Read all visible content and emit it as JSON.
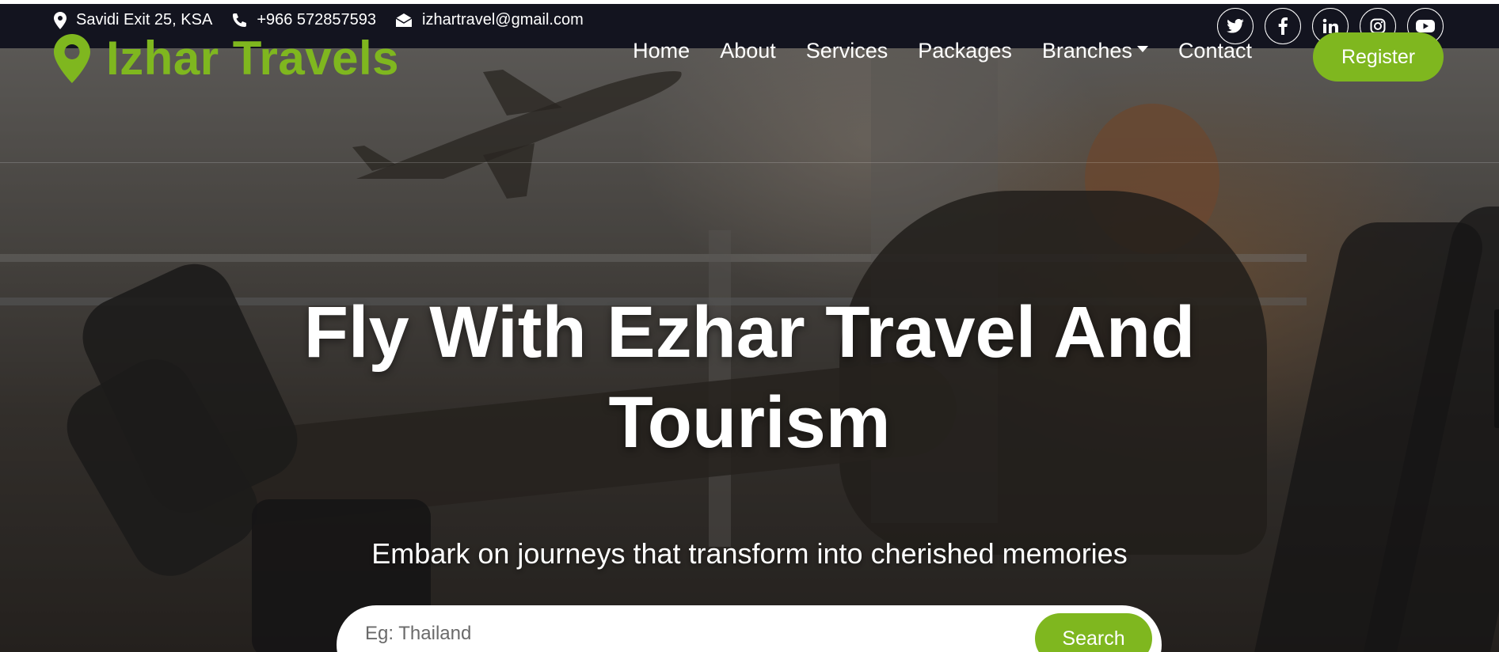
{
  "topbar": {
    "address": "Savidi Exit 25, KSA",
    "phone": "+966 572857593",
    "email": "izhartravel@gmail.com",
    "socials": [
      "twitter-icon",
      "facebook-icon",
      "linkedin-icon",
      "instagram-icon",
      "youtube-icon"
    ]
  },
  "brand": {
    "name": "Izhar Travels",
    "color": "#7fb71f"
  },
  "nav": {
    "items": [
      "Home",
      "About",
      "Services",
      "Packages",
      "Branches",
      "Contact"
    ],
    "register_label": "Register"
  },
  "hero": {
    "headline_line1": "Fly With Ezhar Travel And",
    "headline_line2": "Tourism",
    "subtitle": "Embark on journeys that transform into cherished memories"
  },
  "search": {
    "placeholder": "Eg: Thailand",
    "button_label": "Search"
  },
  "colors": {
    "accent": "#7fb71f",
    "topbar": "#13141f"
  }
}
